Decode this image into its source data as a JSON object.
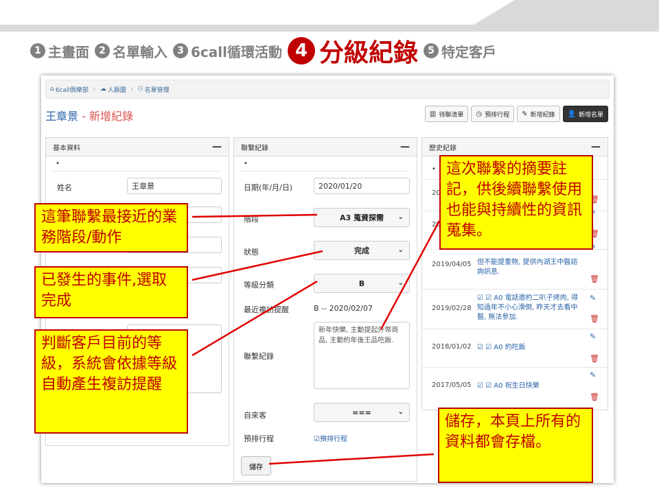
{
  "steps": [
    {
      "num": "1",
      "label": "主畫面"
    },
    {
      "num": "2",
      "label": "名單輸入"
    },
    {
      "num": "3",
      "label": "6call循環活動"
    },
    {
      "num": "4",
      "label": "分級紀錄"
    },
    {
      "num": "5",
      "label": "特定客戶"
    }
  ],
  "breadcrumb": {
    "home": "6call俱樂部",
    "item2": "人脈圖",
    "item3": "名單管理"
  },
  "page": {
    "name": "王章景",
    "sub": " - 新增紀錄"
  },
  "toolbar": {
    "todo": "待聯清單",
    "schedule": "預排行程",
    "add_record": "新增紀錄",
    "add_list": "新增名單"
  },
  "basic": {
    "title": "基本資料",
    "bullet": "•",
    "name_label": "姓名",
    "name_value": "王章景"
  },
  "contact": {
    "title": "聯繫紀錄",
    "bullet": "•",
    "date_label": "日期(年/月/日)",
    "date_value": "2020/01/20",
    "stage_label": "階段",
    "stage_value": "A3 蒐資探需",
    "status_label": "狀態",
    "status_value": "完成",
    "grade_label": "等級分類",
    "grade_value": "B",
    "recent_label": "最近複訪提醒",
    "recent_value": "B -- 2020/02/07",
    "record_label": "聯繫紀錄",
    "record_value": "新年快樂, 主動提起外幣商品, 主動約年後王品吃飯.",
    "walkin_label": "自來客",
    "walkin_value": "===",
    "schedule_label": "預排行程",
    "schedule_link": "預排行程",
    "save": "儲存"
  },
  "history": {
    "title": "歷史紀錄",
    "bullet": "•",
    "rows": [
      {
        "date": "20",
        "text": ""
      },
      {
        "date": "20",
        "text": ""
      },
      {
        "date": "2019/04/05",
        "text": "但不能提重物, 提供內湖王中醫諮詢訊息."
      },
      {
        "date": "2019/02/28",
        "text": "☑ ☑ A0 電話邀約二叭子烤肉, 得知過年不小心滑倒, 昨天才去看中醫, 無法參加."
      },
      {
        "date": "2018/01/02",
        "text": "☑ ☑ A0 約吃飯"
      },
      {
        "date": "2017/05/05",
        "text": "☑ ☑ A0 祝生日快樂"
      }
    ]
  },
  "callouts": {
    "c1": "這筆聯繫最接近的業務階段/動作",
    "c2": "已發生的事件,選取完成",
    "c3": "判斷客戶目前的等級，系統會依據等級自動產生複訪提醒",
    "c4": "這次聯繫的摘要註記，供後續聯繫使用也能與持續性的資訊蒐集。",
    "c5": "儲存，本頁上所有的資料都會存檔。"
  },
  "colors": {
    "accent": "#c00000",
    "callout_bg": "#ffff00",
    "link": "#2a63a8"
  }
}
